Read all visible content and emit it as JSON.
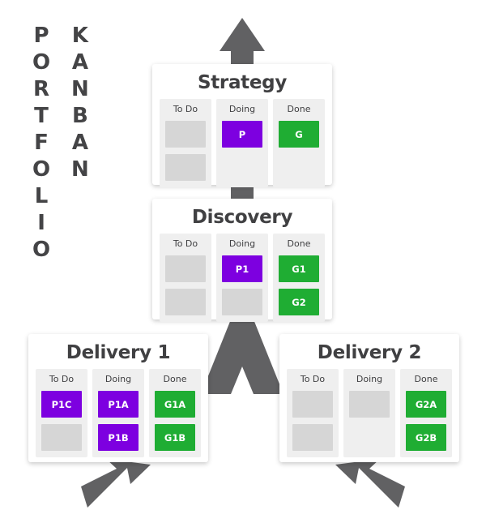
{
  "page": {
    "title_left": "PORTFOLIO",
    "title_right": "KANBAN",
    "background": "#ffffff",
    "title_color": "#444446"
  },
  "colors": {
    "purple": "#7D00E0",
    "green": "#1FAD33",
    "empty_card": "#d6d6d6",
    "column_bg": "#efefef",
    "arrow": "#616163",
    "board_bg": "#ffffff",
    "text_dark": "#404042"
  },
  "columns_labels": {
    "todo": "To Do",
    "doing": "Doing",
    "done": "Done"
  },
  "boards": [
    {
      "id": "strategy",
      "title": "Strategy",
      "columns": [
        {
          "label": "To Do",
          "cards": [
            {
              "label": "",
              "type": "empty"
            },
            {
              "label": "",
              "type": "empty"
            }
          ]
        },
        {
          "label": "Doing",
          "cards": [
            {
              "label": "P",
              "type": "purple"
            },
            {
              "label": "",
              "type": "slot"
            }
          ]
        },
        {
          "label": "Done",
          "cards": [
            {
              "label": "G",
              "type": "green"
            },
            {
              "label": "",
              "type": "slot"
            }
          ]
        }
      ]
    },
    {
      "id": "discovery",
      "title": "Discovery",
      "columns": [
        {
          "label": "To Do",
          "cards": [
            {
              "label": "",
              "type": "empty"
            },
            {
              "label": "",
              "type": "empty"
            }
          ]
        },
        {
          "label": "Doing",
          "cards": [
            {
              "label": "P1",
              "type": "purple"
            },
            {
              "label": "",
              "type": "empty"
            }
          ]
        },
        {
          "label": "Done",
          "cards": [
            {
              "label": "G1",
              "type": "green"
            },
            {
              "label": "G2",
              "type": "green"
            }
          ]
        }
      ]
    },
    {
      "id": "delivery-1",
      "title": "Delivery 1",
      "columns": [
        {
          "label": "To Do",
          "cards": [
            {
              "label": "P1C",
              "type": "purple"
            },
            {
              "label": "",
              "type": "empty"
            }
          ]
        },
        {
          "label": "Doing",
          "cards": [
            {
              "label": "P1A",
              "type": "purple"
            },
            {
              "label": "P1B",
              "type": "purple"
            }
          ]
        },
        {
          "label": "Done",
          "cards": [
            {
              "label": "G1A",
              "type": "green"
            },
            {
              "label": "G1B",
              "type": "green"
            }
          ]
        }
      ]
    },
    {
      "id": "delivery-2",
      "title": "Delivery 2",
      "columns": [
        {
          "label": "To Do",
          "cards": [
            {
              "label": "",
              "type": "empty"
            },
            {
              "label": "",
              "type": "empty"
            }
          ]
        },
        {
          "label": "Doing",
          "cards": [
            {
              "label": "",
              "type": "empty"
            },
            {
              "label": "",
              "type": "slot"
            }
          ]
        },
        {
          "label": "Done",
          "cards": [
            {
              "label": "G2A",
              "type": "green"
            },
            {
              "label": "G2B",
              "type": "green"
            }
          ]
        }
      ]
    }
  ],
  "arrows": [
    {
      "id": "arrow-up-top",
      "direction": "up"
    },
    {
      "id": "connector-strategy-discovery",
      "direction": "vertical-bar"
    },
    {
      "id": "arrow-branch-down",
      "direction": "branch-down"
    },
    {
      "id": "arrow-down-left",
      "direction": "down-left"
    },
    {
      "id": "arrow-down-right",
      "direction": "down-right"
    }
  ]
}
